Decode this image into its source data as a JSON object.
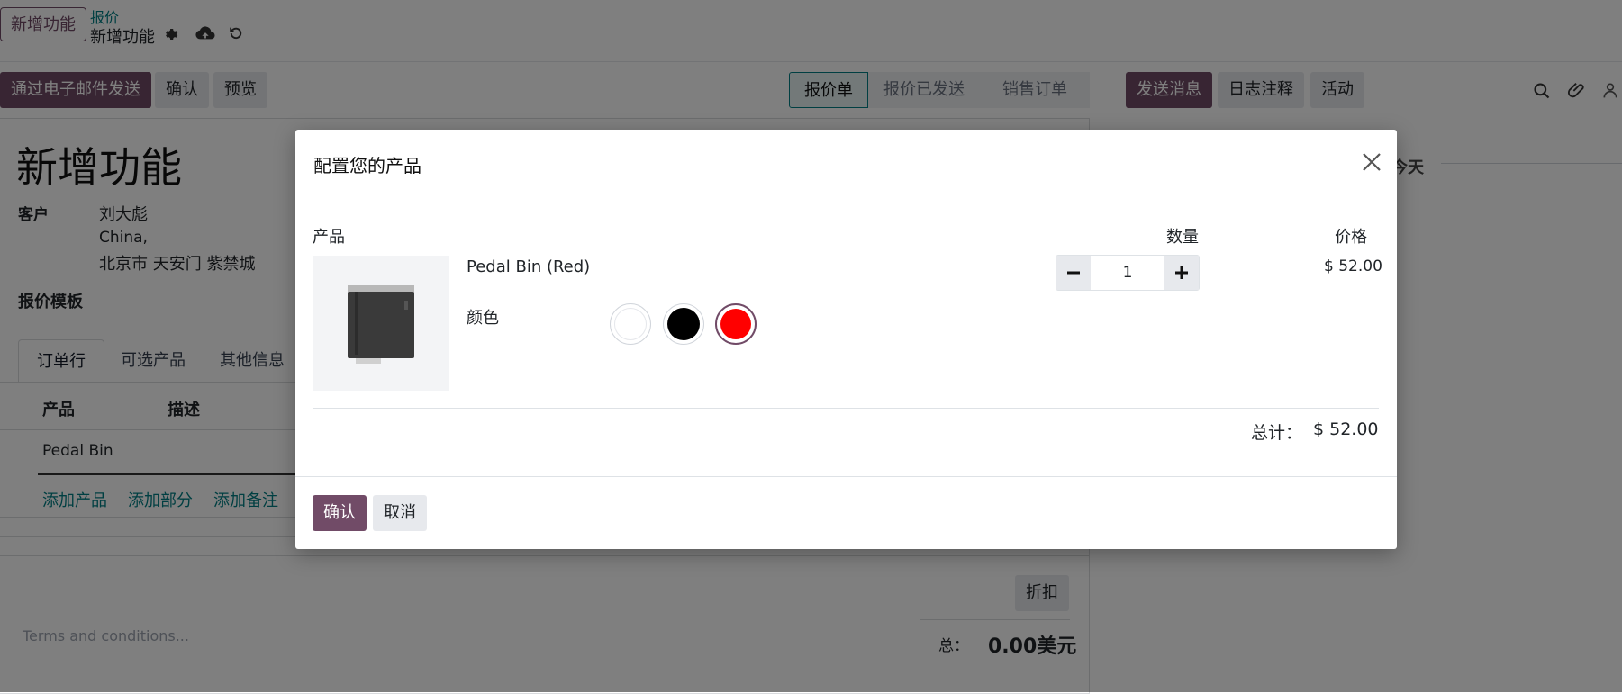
{
  "topbar": {
    "button_label": "新增功能",
    "breadcrumb_parent": "报价",
    "breadcrumb_current": "新增功能"
  },
  "toolbar": {
    "send_email": "通过电子邮件发送",
    "confirm": "确认",
    "preview": "预览"
  },
  "stages": [
    "报价单",
    "报价已发送",
    "销售订单"
  ],
  "chatter": {
    "send_message": "发送消息",
    "log_note": "日志注释",
    "activity": "活动",
    "today": "今天"
  },
  "form": {
    "title": "新增功能",
    "customer_label": "客户",
    "customer_name": "刘大彪",
    "customer_address_line1": "China,",
    "customer_address_line2": "北京市 天安门 紫禁城",
    "template_label": "报价模板",
    "tabs": [
      "订单行",
      "可选产品",
      "其他信息"
    ],
    "col_product": "产品",
    "col_description": "描述",
    "line_product": "Pedal Bin",
    "add_product": "添加产品",
    "add_section": "添加部分",
    "add_note": "添加备注",
    "discount_button": "折扣",
    "terms_placeholder": "Terms and conditions...",
    "total_label": "总：",
    "total_value": "0.00美元"
  },
  "modal": {
    "title": "配置您的产品",
    "col_product": "产品",
    "col_quantity": "数量",
    "col_price": "价格",
    "product_name": "Pedal Bin (Red)",
    "attribute_label": "颜色",
    "swatches": [
      {
        "name": "white",
        "color": "#ffffff",
        "selected": false
      },
      {
        "name": "black",
        "color": "#000000",
        "selected": false
      },
      {
        "name": "red",
        "color": "#ff0000",
        "selected": true
      }
    ],
    "quantity": "1",
    "price": "$ 52.00",
    "total_label": "总计：",
    "total_value": "$ 52.00",
    "confirm": "确认",
    "cancel": "取消"
  },
  "colors": {
    "primary": "#714b67",
    "link": "#017e84",
    "selected_swatch_border": "#714b67"
  }
}
